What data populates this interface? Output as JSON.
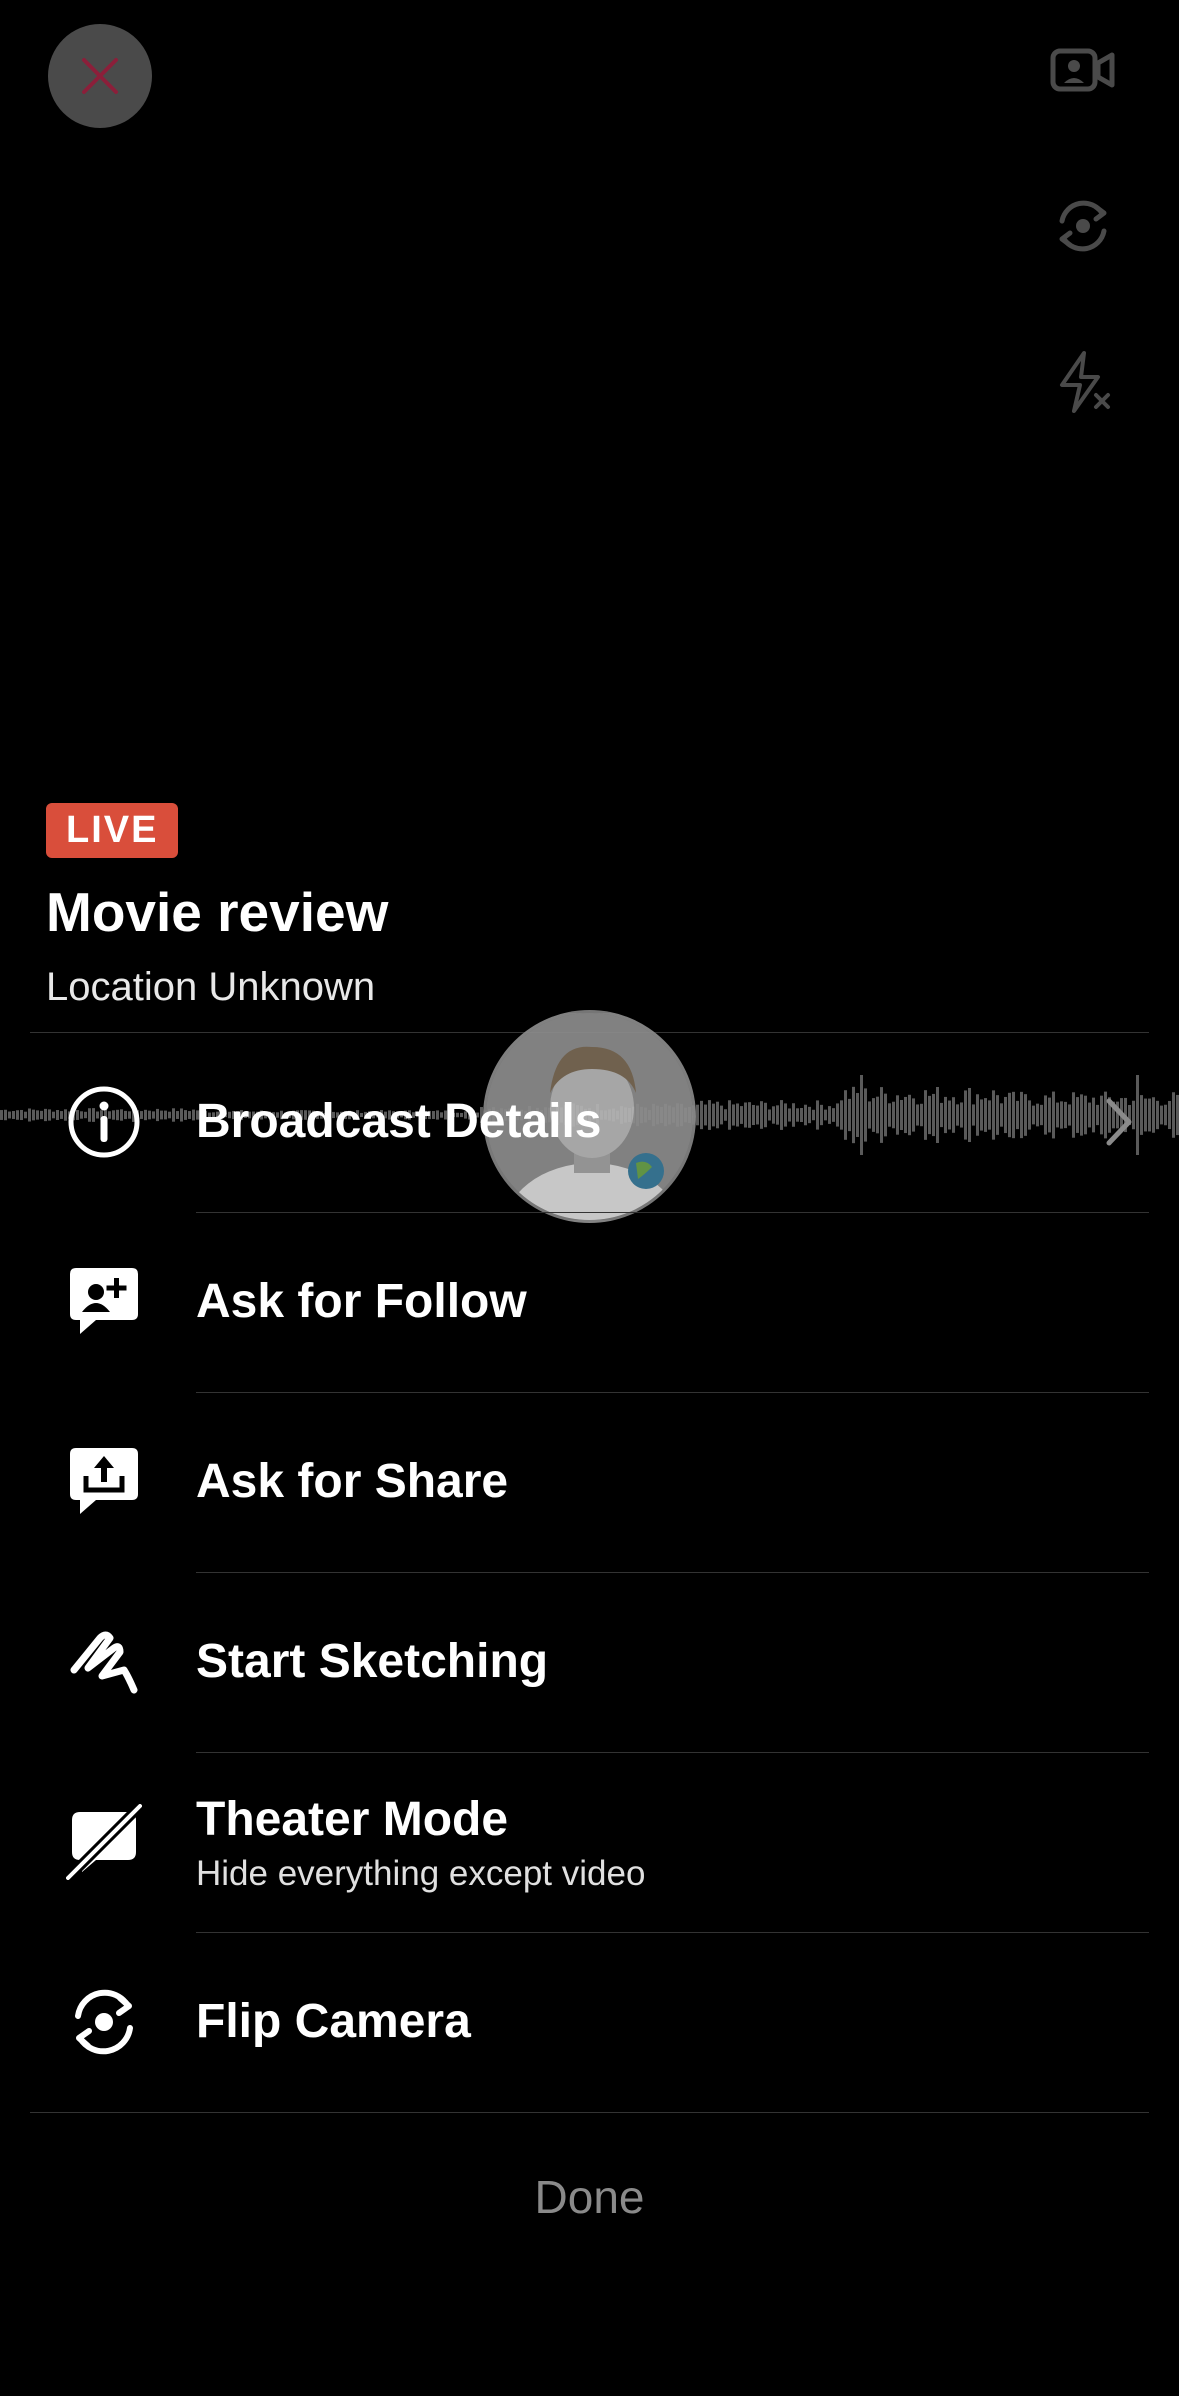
{
  "header": {
    "live_label": "LIVE",
    "title": "Movie review",
    "location": "Location Unknown"
  },
  "top_controls": {
    "close_icon": "close-icon",
    "video_icon": "video-camera-icon",
    "flip_icon": "flip-camera-icon",
    "flash_icon": "flash-off-icon"
  },
  "menu": {
    "items": [
      {
        "label": "Broadcast Details",
        "icon": "info-icon"
      },
      {
        "label": "Ask for Follow",
        "icon": "ask-follow-icon"
      },
      {
        "label": "Ask for Share",
        "icon": "ask-share-icon"
      },
      {
        "label": "Start Sketching",
        "icon": "sketch-icon"
      },
      {
        "label": "Theater Mode",
        "sublabel": "Hide everything except video",
        "icon": "theater-mode-icon"
      },
      {
        "label": "Flip Camera",
        "icon": "flip-camera-icon"
      }
    ]
  },
  "done_label": "Done",
  "colors": {
    "live_badge": "#d94e3b",
    "close_x": "#8b1f3a",
    "done_text": "#8a8a8a",
    "background": "#000000"
  }
}
